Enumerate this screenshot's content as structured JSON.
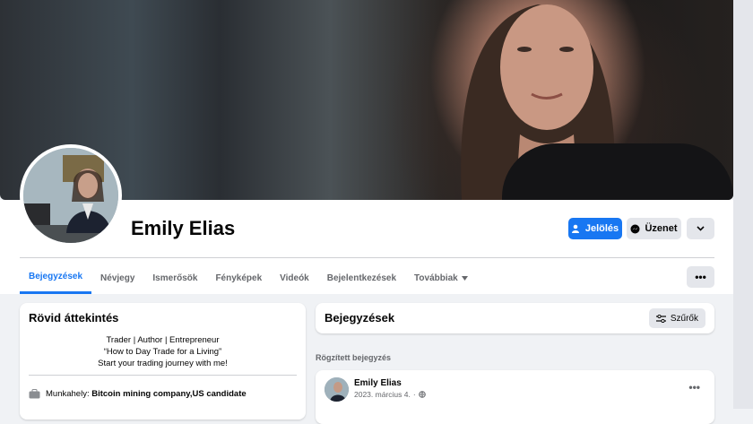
{
  "profile": {
    "name": "Emily Elias"
  },
  "actions": {
    "primary_label": "Jelölés",
    "message_label": "Üzenet"
  },
  "tabs": [
    {
      "label": "Bejegyzések",
      "active": true
    },
    {
      "label": "Névjegy"
    },
    {
      "label": "Ismerősök"
    },
    {
      "label": "Fényképek"
    },
    {
      "label": "Videók"
    },
    {
      "label": "Bejelentkezések"
    },
    {
      "label": "Továbbiak"
    }
  ],
  "intro": {
    "title": "Rövid áttekintés",
    "bio": [
      "Trader | Author | Entrepreneur",
      "“How to Day Trade for a Living”",
      "Start your trading journey with me!"
    ],
    "work_prefix": "Munkahely: ",
    "work_value": "Bitcoin mining company,US candidate"
  },
  "posts": {
    "title": "Bejegyzések",
    "filter_label": "Szűrők",
    "pinned_label": "Rögzített bejegyzés",
    "first": {
      "author": "Emily Elias",
      "date": "2023. március 4."
    }
  },
  "colors": {
    "accent": "#1877f2",
    "secondary_bg": "#e4e6eb",
    "page_bg": "#f0f2f5"
  }
}
